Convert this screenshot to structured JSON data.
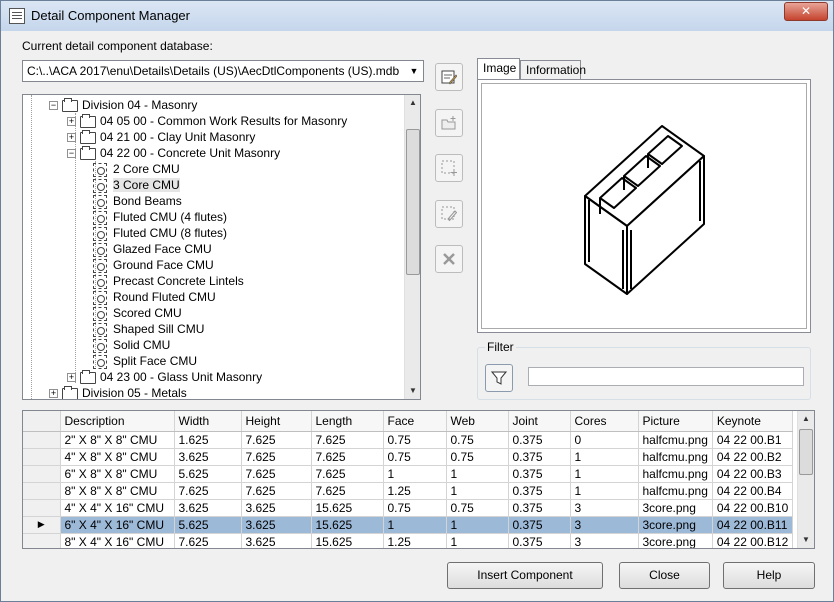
{
  "window": {
    "title": "Detail Component Manager",
    "close_glyph": "✕"
  },
  "database": {
    "label": "Current detail component database:",
    "value": "C:\\..\\ACA 2017\\enu\\Details\\Details (US)\\AecDtlComponents (US).mdb",
    "arrow_glyph": "▼"
  },
  "tree": {
    "items": [
      {
        "label": "Division 04 - Masonry",
        "expander": "−",
        "kind": "folder"
      },
      {
        "label": "04 05 00 - Common Work Results for Masonry",
        "expander": "+",
        "kind": "folder"
      },
      {
        "label": "04 21 00 - Clay Unit Masonry",
        "expander": "+",
        "kind": "folder"
      },
      {
        "label": "04 22 00 - Concrete Unit Masonry",
        "expander": "−",
        "kind": "folder"
      },
      {
        "label": "2 Core CMU",
        "kind": "component"
      },
      {
        "label": "3 Core CMU",
        "kind": "component",
        "selected": true
      },
      {
        "label": "Bond Beams",
        "kind": "component"
      },
      {
        "label": "Fluted CMU (4 flutes)",
        "kind": "component"
      },
      {
        "label": "Fluted CMU (8 flutes)",
        "kind": "component"
      },
      {
        "label": "Glazed Face CMU",
        "kind": "component"
      },
      {
        "label": "Ground Face CMU",
        "kind": "component"
      },
      {
        "label": "Precast Concrete Lintels",
        "kind": "component"
      },
      {
        "label": "Round Fluted CMU",
        "kind": "component"
      },
      {
        "label": "Scored CMU",
        "kind": "component"
      },
      {
        "label": "Shaped Sill CMU",
        "kind": "component"
      },
      {
        "label": "Solid CMU",
        "kind": "component"
      },
      {
        "label": "Split Face CMU",
        "kind": "component"
      },
      {
        "label": "04 23 00 - Glass Unit Masonry",
        "expander": "+",
        "kind": "folder"
      },
      {
        "label": "Division 05 - Metals",
        "expander": "+",
        "kind": "folder"
      }
    ],
    "scroll_up": "▲",
    "scroll_down": "▼"
  },
  "tools": [
    {
      "name": "edit-database-icon"
    },
    {
      "name": "new-group-icon"
    },
    {
      "name": "new-component-icon"
    },
    {
      "name": "edit-component-icon"
    },
    {
      "name": "delete-icon"
    }
  ],
  "tabs": {
    "image": "Image",
    "information": "Information"
  },
  "filter": {
    "label": "Filter",
    "value": ""
  },
  "grid": {
    "columns": [
      "Description",
      "Width",
      "Height",
      "Length",
      "Face",
      "Web",
      "Joint",
      "Cores",
      "Picture",
      "Keynote"
    ],
    "current_row_marker": "▶",
    "rows": [
      [
        "2\" X 8\" X 8\" CMU",
        "1.625",
        "7.625",
        "7.625",
        "0.75",
        "0.75",
        "0.375",
        "0",
        "halfcmu.png",
        "04 22 00.B1"
      ],
      [
        "4\" X 8\" X 8\" CMU",
        "3.625",
        "7.625",
        "7.625",
        "0.75",
        "0.75",
        "0.375",
        "1",
        "halfcmu.png",
        "04 22 00.B2"
      ],
      [
        "6\" X 8\" X 8\" CMU",
        "5.625",
        "7.625",
        "7.625",
        "1",
        "1",
        "0.375",
        "1",
        "halfcmu.png",
        "04 22 00.B3"
      ],
      [
        "8\" X 8\" X 8\" CMU",
        "7.625",
        "7.625",
        "7.625",
        "1.25",
        "1",
        "0.375",
        "1",
        "halfcmu.png",
        "04 22 00.B4"
      ],
      [
        "4\" X 4\" X 16\" CMU",
        "3.625",
        "3.625",
        "15.625",
        "0.75",
        "0.75",
        "0.375",
        "3",
        "3core.png",
        "04 22 00.B10"
      ],
      [
        "6\" X 4\" X 16\" CMU",
        "5.625",
        "3.625",
        "15.625",
        "1",
        "1",
        "0.375",
        "3",
        "3core.png",
        "04 22 00.B11"
      ],
      [
        "8\" X 4\" X 16\" CMU",
        "7.625",
        "3.625",
        "15.625",
        "1.25",
        "1",
        "0.375",
        "3",
        "3core.png",
        "04 22 00.B12"
      ]
    ],
    "selected_row": 5
  },
  "buttons": {
    "insert": "Insert Component",
    "close": "Close",
    "help": "Help"
  }
}
